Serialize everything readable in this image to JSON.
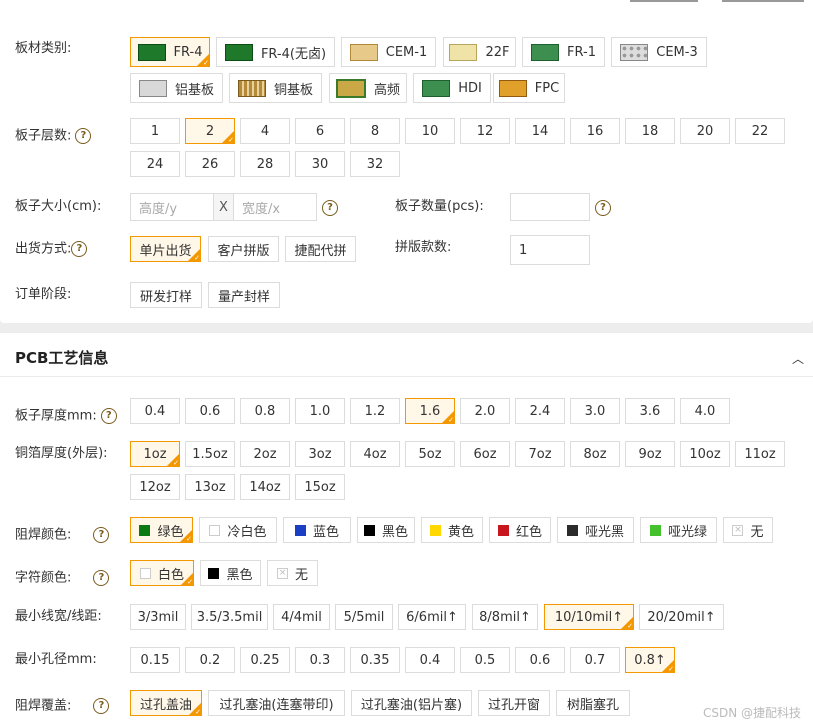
{
  "colors": {
    "accent": "#f39800",
    "selected_bg": "#fff7e8",
    "border": "#dcdcdc"
  },
  "board_info": {
    "material_label": "板材类别:",
    "materials": [
      {
        "label": "FR-4",
        "selected": true,
        "thumb": "green-pcb"
      },
      {
        "label": "FR-4(无卤)",
        "selected": false,
        "thumb": "green-pcb"
      },
      {
        "label": "CEM-1",
        "selected": false,
        "thumb": "yellow-pcb"
      },
      {
        "label": "22F",
        "selected": false,
        "thumb": "cream-pcb"
      },
      {
        "label": "FR-1",
        "selected": false,
        "thumb": "green-board"
      },
      {
        "label": "CEM-3",
        "selected": false,
        "thumb": "grey-circles"
      },
      {
        "label": "铝基板",
        "selected": false,
        "thumb": "aluminum"
      },
      {
        "label": "铜基板",
        "selected": false,
        "thumb": "copper"
      },
      {
        "label": "高频",
        "selected": false,
        "thumb": "hf-board"
      },
      {
        "label": "HDI",
        "selected": false,
        "thumb": "green-board"
      },
      {
        "label": "FPC",
        "selected": false,
        "thumb": "fpc-board"
      }
    ],
    "layers_label": "板子层数:",
    "layers": [
      "1",
      "2",
      "4",
      "6",
      "8",
      "10",
      "12",
      "14",
      "16",
      "18",
      "20",
      "22",
      "24",
      "26",
      "28",
      "30",
      "32"
    ],
    "layers_selected": "2",
    "size_label": "板子大小(cm):",
    "height_placeholder": "高度/y",
    "x_sep": "X",
    "width_placeholder": "宽度/x",
    "qty_label": "板子数量(pcs):",
    "qty_value": "",
    "ship_label": "出货方式:",
    "ship_options": [
      "单片出货",
      "客户拼版",
      "捷配代拼"
    ],
    "ship_selected": "单片出货",
    "panel_count_label": "拼版款数:",
    "panel_count_value": "1",
    "stage_label": "订单阶段:",
    "stage_options": [
      "研发打样",
      "量产封样"
    ]
  },
  "pcb_process": {
    "title": "PCB工艺信息",
    "thickness_label": "板子厚度mm:",
    "thickness": [
      "0.4",
      "0.6",
      "0.8",
      "1.0",
      "1.2",
      "1.6",
      "2.0",
      "2.4",
      "3.0",
      "3.6",
      "4.0"
    ],
    "thickness_selected": "1.6",
    "copper_label": "铜箔厚度(外层):",
    "copper": [
      "1oz",
      "1.5oz",
      "2oz",
      "3oz",
      "4oz",
      "5oz",
      "6oz",
      "7oz",
      "8oz",
      "9oz",
      "10oz",
      "11oz",
      "12oz",
      "13oz",
      "14oz",
      "15oz"
    ],
    "copper_selected": "1oz",
    "mask_label": "阻焊颜色:",
    "mask_colors": [
      {
        "label": "绿色",
        "color": "#0a7a12",
        "selected": true
      },
      {
        "label": "冷白色",
        "color": "#ffffff",
        "selected": false
      },
      {
        "label": "蓝色",
        "color": "#1a3fc4",
        "selected": false
      },
      {
        "label": "黑色",
        "color": "#000000",
        "selected": false
      },
      {
        "label": "黄色",
        "color": "#ffd800",
        "selected": false
      },
      {
        "label": "红色",
        "color": "#c8161e",
        "selected": false
      },
      {
        "label": "哑光黑",
        "color": "#2b2b2b",
        "selected": false
      },
      {
        "label": "哑光绿",
        "color": "#46c12e",
        "selected": false
      },
      {
        "label": "无",
        "color": "none",
        "selected": false
      }
    ],
    "silk_label": "字符颜色:",
    "silk_colors": [
      {
        "label": "白色",
        "color": "#ffffff",
        "selected": true
      },
      {
        "label": "黑色",
        "color": "#000000",
        "selected": false
      },
      {
        "label": "无",
        "color": "none",
        "selected": false
      }
    ],
    "trace_label": "最小线宽/线距:",
    "trace": [
      "3/3mil",
      "3.5/3.5mil",
      "4/4mil",
      "5/5mil",
      "6/6mil↑",
      "8/8mil↑",
      "10/10mil↑",
      "20/20mil↑"
    ],
    "trace_selected": "10/10mil↑",
    "hole_label": "最小孔径mm:",
    "hole": [
      "0.15",
      "0.2",
      "0.25",
      "0.3",
      "0.35",
      "0.4",
      "0.5",
      "0.6",
      "0.7",
      "0.8↑"
    ],
    "hole_selected": "0.8↑",
    "cover_label": "阻焊覆盖:",
    "cover": [
      "过孔盖油",
      "过孔塞油(连塞带印)",
      "过孔塞油(铝片塞)",
      "过孔开窗",
      "树脂塞孔"
    ],
    "cover_selected": "过孔盖油"
  },
  "watermark": "CSDN @捷配科技"
}
